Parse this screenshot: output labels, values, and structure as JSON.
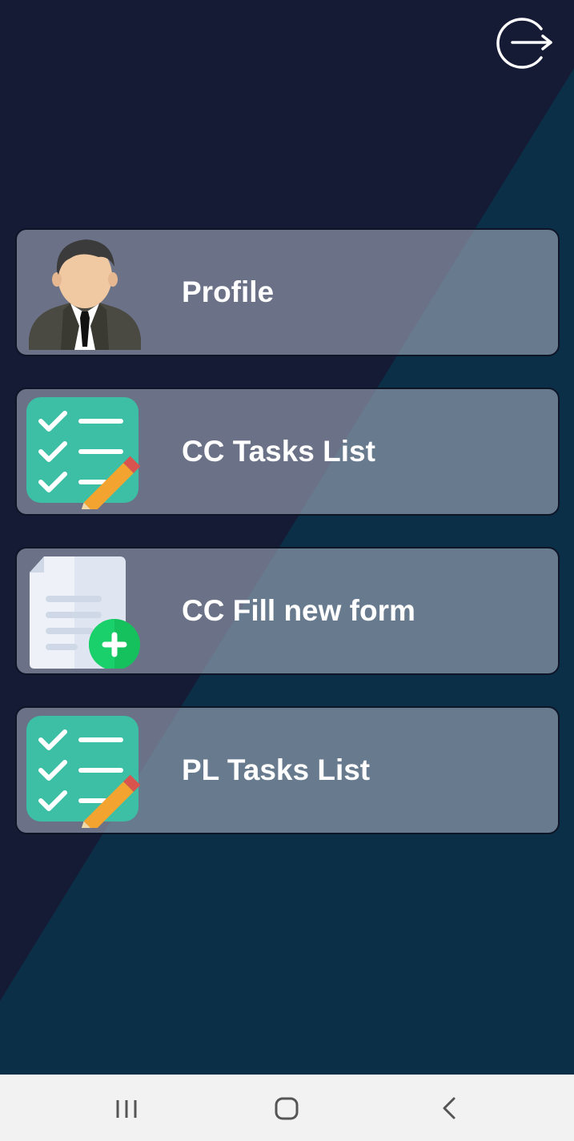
{
  "colors": {
    "bg_dark": "#151a35",
    "bg_teal": "#0b2f47",
    "card_fill": "#a0aab9",
    "text": "#ffffff",
    "navbar_bg": "#f2f2f2",
    "checklist_green": "#3cbfa5",
    "plus_green": "#15c15d"
  },
  "header": {
    "logout_icon": "logout-icon"
  },
  "menu": {
    "items": [
      {
        "label": "Profile",
        "icon": "profile-avatar-icon"
      },
      {
        "label": "CC Tasks List",
        "icon": "checklist-pencil-icon"
      },
      {
        "label": "CC Fill new form",
        "icon": "document-add-icon"
      },
      {
        "label": "PL Tasks List",
        "icon": "checklist-pencil-icon"
      }
    ]
  },
  "navbar": {
    "recents_icon": "recents-icon",
    "home_icon": "home-icon",
    "back_icon": "back-icon"
  }
}
